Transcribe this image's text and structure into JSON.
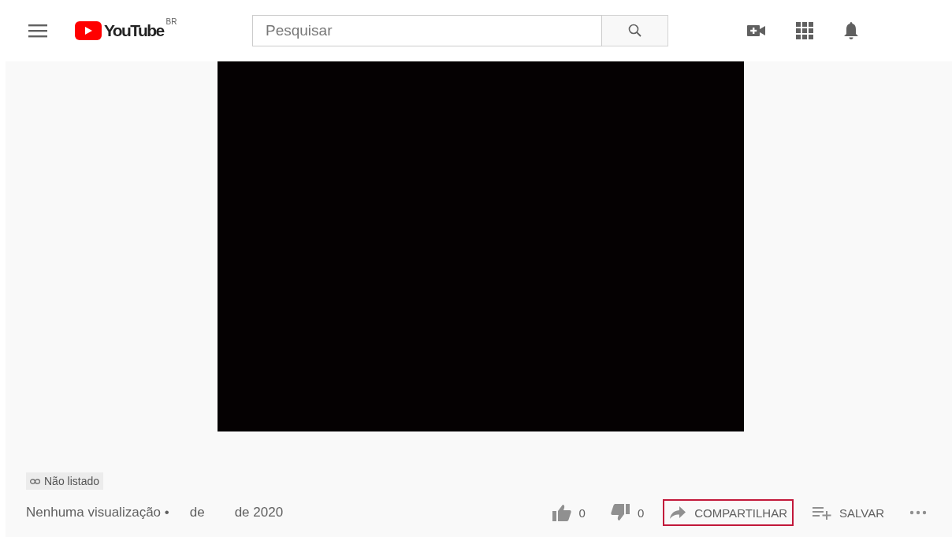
{
  "header": {
    "logo_text": "YouTube",
    "logo_region": "BR",
    "search": {
      "placeholder": "Pesquisar"
    }
  },
  "video": {
    "kind": "blank"
  },
  "badge": {
    "label": "Não listado"
  },
  "info": {
    "views": "Nenhuma visualização •",
    "date_parts": [
      "de",
      "de 2020"
    ]
  },
  "actions": [
    {
      "kind": "like",
      "label": "0",
      "highlighted": false
    },
    {
      "kind": "dislike",
      "label": "0",
      "highlighted": false
    },
    {
      "kind": "share",
      "label": "COMPARTILHAR",
      "highlighted": true
    },
    {
      "kind": "save",
      "label": "SALVAR",
      "highlighted": false
    },
    {
      "kind": "more",
      "highlighted": false
    }
  ]
}
